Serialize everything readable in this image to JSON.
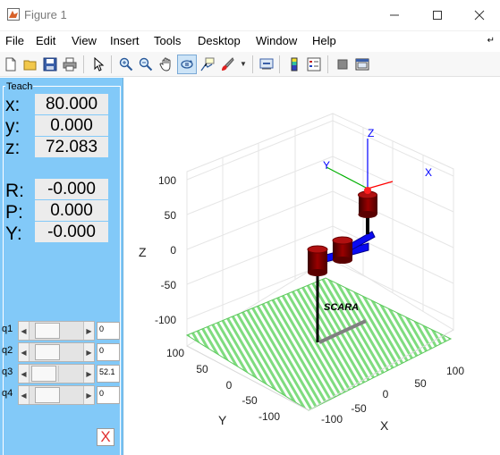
{
  "window": {
    "title": "Figure 1",
    "minimize_icon": "minimize-icon",
    "maximize_icon": "maximize-icon",
    "close_icon": "close-icon"
  },
  "menu": {
    "items": [
      "File",
      "Edit",
      "View",
      "Insert",
      "Tools",
      "Desktop",
      "Window",
      "Help"
    ],
    "dock_icon": "dock-arrow-icon"
  },
  "toolbar": {
    "icons": [
      "new-figure-icon",
      "open-file-icon",
      "save-icon",
      "print-icon",
      "pointer-icon",
      "zoom-in-icon",
      "zoom-out-icon",
      "pan-icon",
      "rotate-3d-icon",
      "data-cursor-icon",
      "brush-icon",
      "link-icon",
      "colorbar-icon",
      "legend-icon",
      "hide-plot-tools-icon",
      "show-plot-tools-icon"
    ],
    "active": "rotate-3d-icon"
  },
  "teach": {
    "title": "Teach",
    "coords": [
      {
        "label": "x:",
        "value": "80.000"
      },
      {
        "label": "y:",
        "value": "0.000"
      },
      {
        "label": "z:",
        "value": "72.083"
      },
      {
        "label": "R:",
        "value": "-0.000"
      },
      {
        "label": "P:",
        "value": "0.000"
      },
      {
        "label": "Y:",
        "value": "-0.000"
      }
    ],
    "joints": [
      {
        "label": "q1",
        "value": "0"
      },
      {
        "label": "q2",
        "value": "0"
      },
      {
        "label": "q3",
        "value": "52.1"
      },
      {
        "label": "q4",
        "value": "0"
      }
    ],
    "close_label": "X"
  },
  "plot": {
    "z_label": "Z",
    "y_label": "Y",
    "x_label": "X",
    "z_ticks": [
      "100",
      "50",
      "0",
      "-50",
      "-100"
    ],
    "y_ticks": [
      "100",
      "50",
      "0",
      "-50",
      "-100"
    ],
    "x_ticks": [
      "-100",
      "-50",
      "0",
      "50",
      "100"
    ],
    "robot_name": "SCARA",
    "frame_labels": {
      "z": "Z",
      "y": "Y",
      "x": "X"
    },
    "colors": {
      "link": "#0a0af0",
      "joint": "#8b0000",
      "floor": "#7fdc7f",
      "frame_x": "#ff0000",
      "frame_y": "#00b000",
      "frame_z": "#0000ff"
    }
  }
}
